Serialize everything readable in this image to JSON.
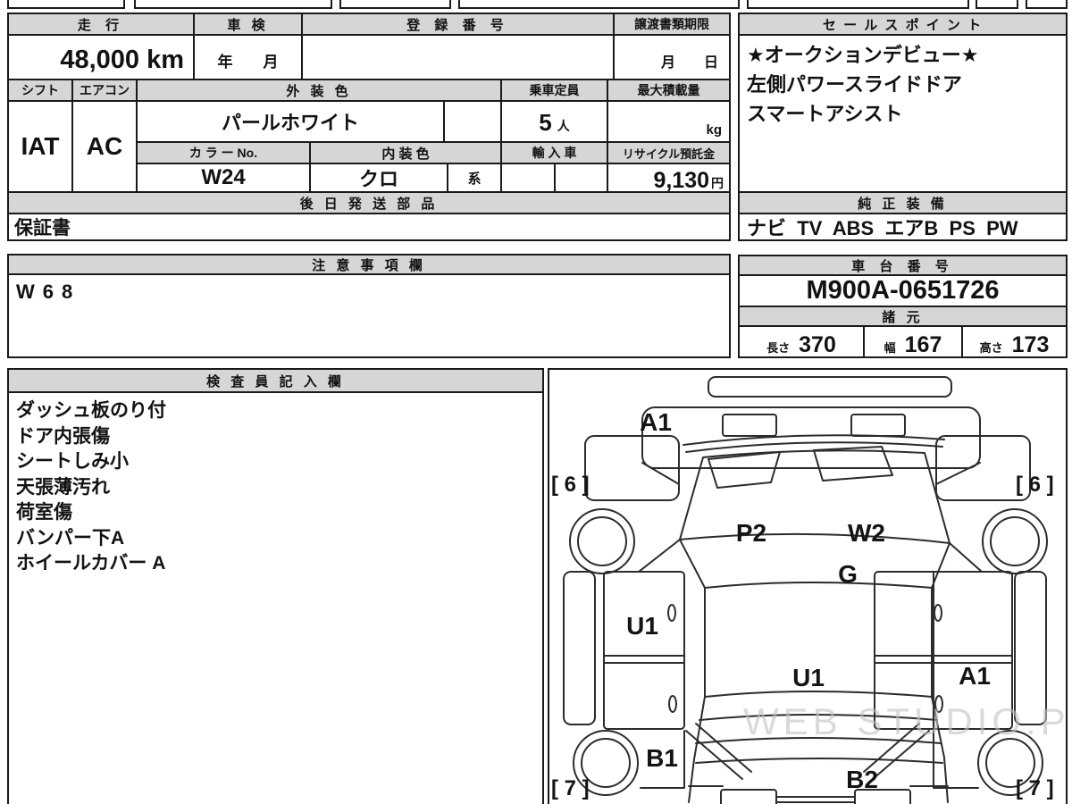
{
  "sheet": {
    "header_bg": "#d6d6d6",
    "border_color": "#1a1a1a",
    "watermark": "WEB STUDIO.PRO"
  },
  "mileage": {
    "label": "走 行",
    "value": "48,000 km"
  },
  "shaken": {
    "label": "車 検",
    "placeholder": "年　　月"
  },
  "registration": {
    "label": "登 録 番 号",
    "value": ""
  },
  "transfer": {
    "label": "譲渡書類期限",
    "placeholder": "月　　日"
  },
  "shift": {
    "label": "シフト",
    "value": "IAT"
  },
  "aircon": {
    "label": "エアコン",
    "value": "AC"
  },
  "exterior": {
    "label": "外 装 色",
    "value": "パールホワイト"
  },
  "capacity": {
    "label": "乗車定員",
    "value": "5",
    "unit": "人"
  },
  "max_load": {
    "label": "最大積載量",
    "unit": "kg"
  },
  "color_no": {
    "label": "カ ラ ー No.",
    "value": "W24"
  },
  "interior": {
    "label": "内 装 色",
    "value": "クロ",
    "suffix": "系"
  },
  "import_car": {
    "label": "輸 入 車",
    "value": ""
  },
  "recycle": {
    "label": "リサイクル預託金",
    "value": "9,130",
    "unit": "円"
  },
  "later_parts": {
    "label": "後 日 発 送 部 品",
    "value": "保証書"
  },
  "sales_points": {
    "label": "セ ー ル ス ポ イ ン ト",
    "lines": [
      "★オークションデビュー★",
      "左側パワースライドドア",
      "スマートアシスト"
    ]
  },
  "equipment": {
    "label": "純 正 装 備",
    "value": "ナビ  TV  ABS  エアB  PS  PW"
  },
  "notes": {
    "label": "注 意 事 項 欄",
    "value": "W68"
  },
  "chassis": {
    "label": "車 台 番 号",
    "value": "M900A-0651726"
  },
  "specs": {
    "label": "諸 元",
    "length_label": "長さ",
    "length": "370",
    "width_label": "幅",
    "width": "167",
    "height_label": "高さ",
    "height": "173"
  },
  "inspector": {
    "label": "検 査 員 記 入 欄",
    "lines": [
      "ダッシュ板のり付",
      "ドア内張傷",
      "シートしみ小",
      "天張薄汚れ",
      "荷室傷",
      "バンパー下A",
      "ホイールカバー A"
    ]
  },
  "diagram": {
    "damage_labels": {
      "front_bumper": "A1",
      "windshield_left": "P2",
      "windshield_right": "W2",
      "glass": "G",
      "left_door": "U1",
      "roof": "U1",
      "right_door": "A1",
      "rear_left_fender": "B1",
      "rear_gate": "B2"
    },
    "tire_treads": {
      "front_left": "[ 6 ]",
      "front_right": "[ 6 ]",
      "rear_left": "[ 7 ]",
      "rear_right": "[ 7 ]"
    }
  }
}
